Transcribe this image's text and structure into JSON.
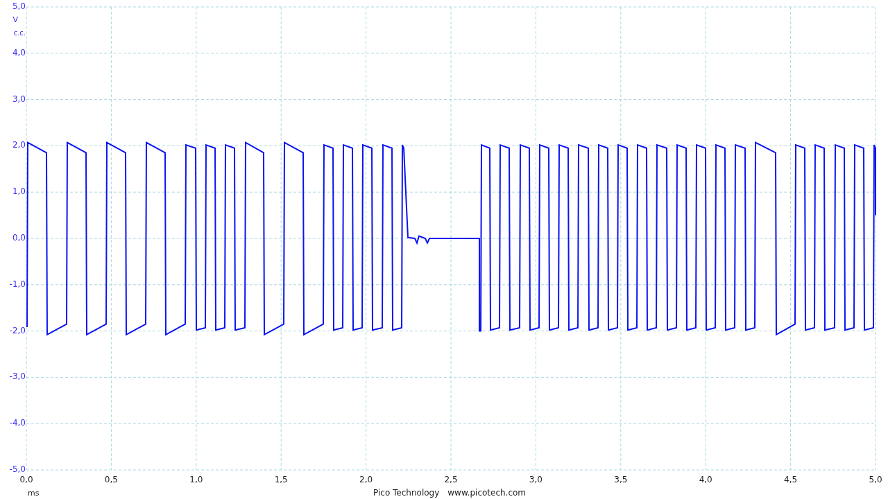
{
  "y_axis": {
    "unit": "V",
    "coupling": "c.c.",
    "ticks": [
      "5,0",
      "4,0",
      "3,0",
      "2,0",
      "1,0",
      "0,0",
      "-1,0",
      "-2,0",
      "-3,0",
      "-4,0",
      "-5,0"
    ]
  },
  "x_axis": {
    "unit": "ms",
    "ticks": [
      "0,0",
      "0,5",
      "1,0",
      "1,5",
      "2,0",
      "2,5",
      "3,0",
      "3,5",
      "4,0",
      "4,5",
      "5,0"
    ]
  },
  "footer": {
    "company": "Pico Technology",
    "website": "www.picotech.com"
  }
}
